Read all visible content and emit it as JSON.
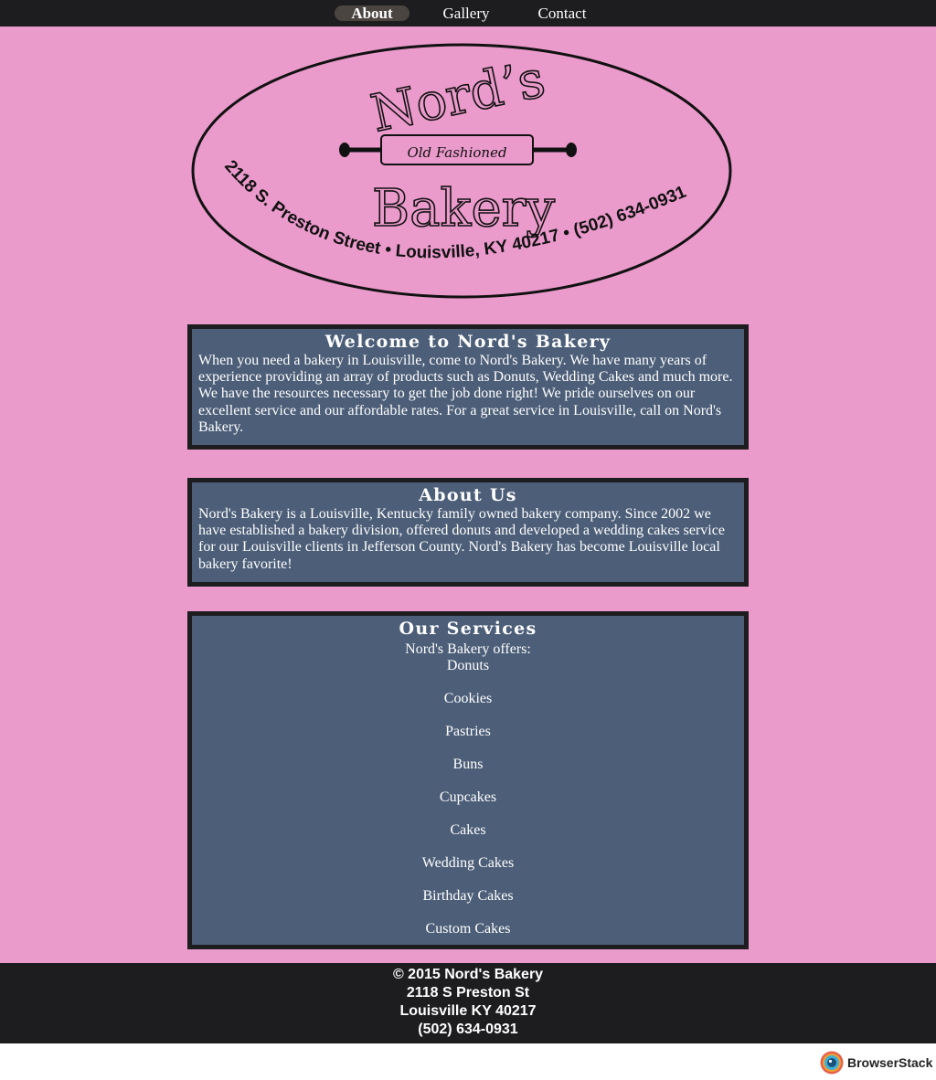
{
  "nav": {
    "items": [
      {
        "label": "About"
      },
      {
        "label": "Gallery"
      },
      {
        "label": "Contact"
      }
    ]
  },
  "logo": {
    "name": "Nord’s",
    "tagline": "Old Fashioned",
    "bakery": "Bakery",
    "address": "2118 S. Preston Street • Louisville, KY 40217 • (502) 634-0931"
  },
  "welcome": {
    "title": "Welcome to Nord's Bakery",
    "text": "When you need a bakery in Louisville, come to Nord's Bakery. We have many years of experience providing an array of products such as Donuts, Wedding Cakes and much more. We have the resources necessary to get the job done right! We pride ourselves on our excellent service and our affordable rates. For a great service in Louisville, call on Nord's Bakery."
  },
  "about": {
    "title": "About Us",
    "text": "Nord's Bakery is a Louisville, Kentucky family owned bakery company. Since 2002 we have established a bakery division, offered donuts and developed a wedding cakes service for our Louisville clients in Jefferson County. Nord's Bakery has become Louisville local bakery favorite!"
  },
  "services": {
    "title": "Our Services",
    "intro": "Nord's Bakery offers:",
    "items": [
      "Donuts",
      "Cookies",
      "Pastries",
      "Buns",
      "Cupcakes",
      "Cakes",
      "Wedding Cakes",
      "Birthday Cakes",
      "Custom Cakes"
    ]
  },
  "footer": {
    "copyright": "© 2015 Nord's Bakery",
    "street": "2118 S Preston St",
    "city": "Louisville KY 40217",
    "phone": "(502) 634-0931"
  },
  "badge": {
    "label": "BrowserStack"
  },
  "colors": {
    "page_bg": "#ea9acb",
    "nav_bg": "#1d1d20",
    "box_bg": "#4c5e78",
    "text": "#ffffff"
  }
}
